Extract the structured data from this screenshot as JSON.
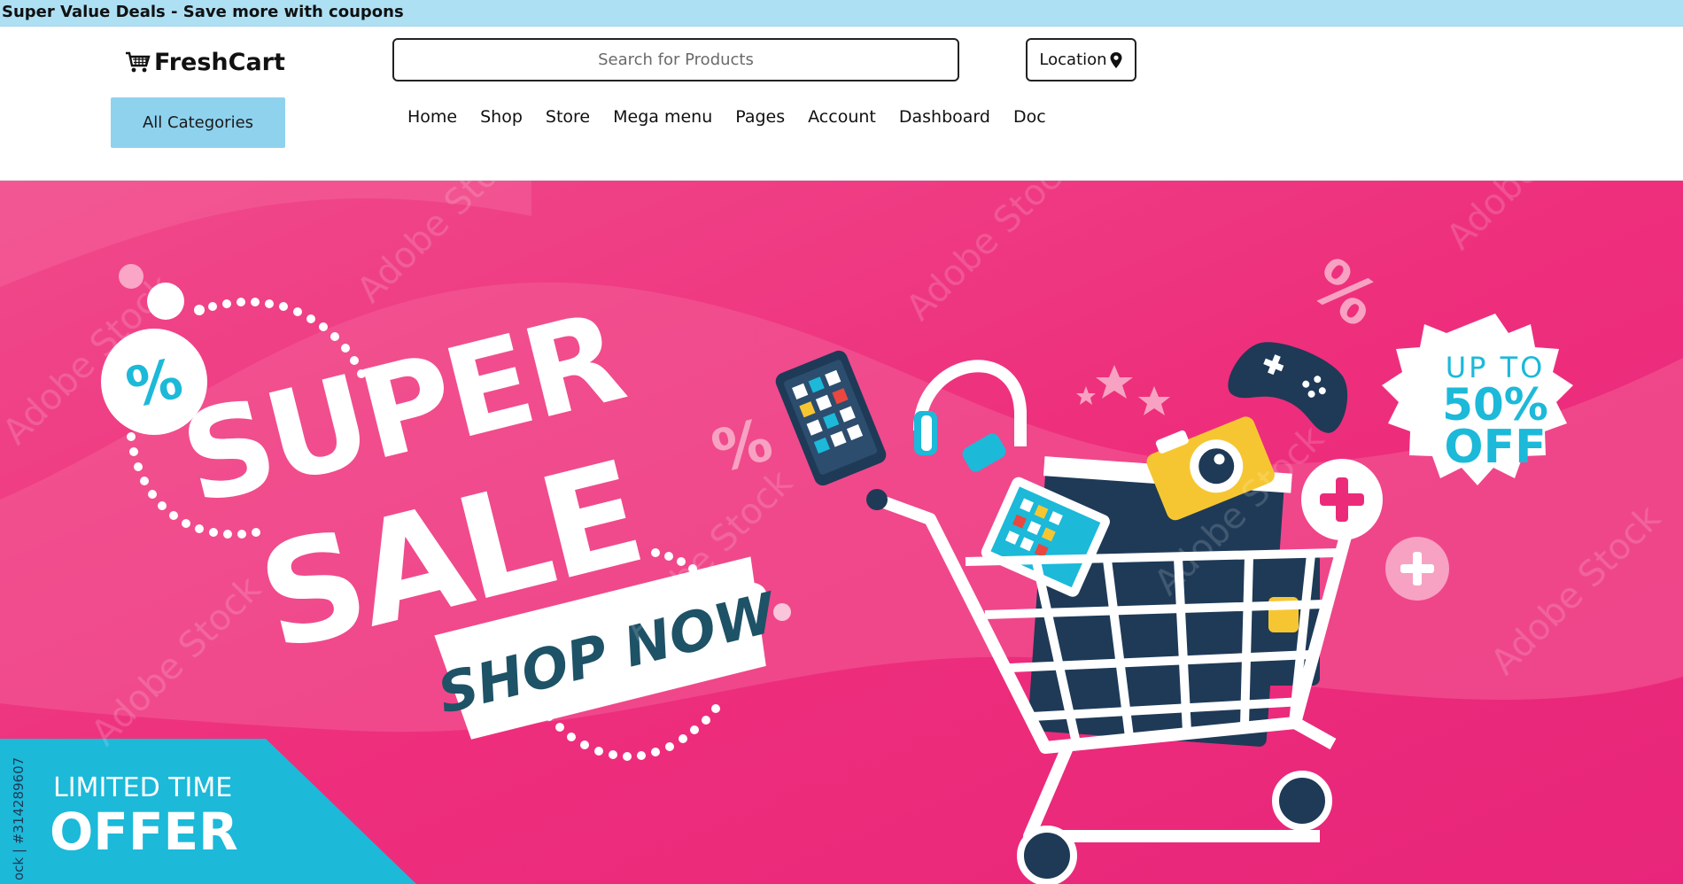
{
  "promo_bar": {
    "text": "Super Value Deals - Save more with coupons"
  },
  "header": {
    "logo_text": "FreshCart",
    "search": {
      "placeholder": "Search for Products",
      "value": ""
    },
    "location_label": "Location",
    "categories_label": "All Categories",
    "nav": [
      "Home",
      "Shop",
      "Store",
      "Mega menu",
      "Pages",
      "Account",
      "Dashboard",
      "Doc"
    ]
  },
  "banner": {
    "headline_line1": "SUPER",
    "headline_line2": "SALE",
    "cta": "SHOP NOW",
    "badge_line1": "UP TO",
    "badge_line2": "50%",
    "badge_line3": "OFF",
    "corner_line1": "LIMITED TIME",
    "corner_line2": "OFFER",
    "watermark": "Adobe Stock",
    "stock_id": "ock | #314289607",
    "colors": {
      "pink": "#ec2a7a",
      "cyan": "#1cb9d9",
      "navy": "#1e3a57",
      "yellow": "#f6c632"
    }
  }
}
